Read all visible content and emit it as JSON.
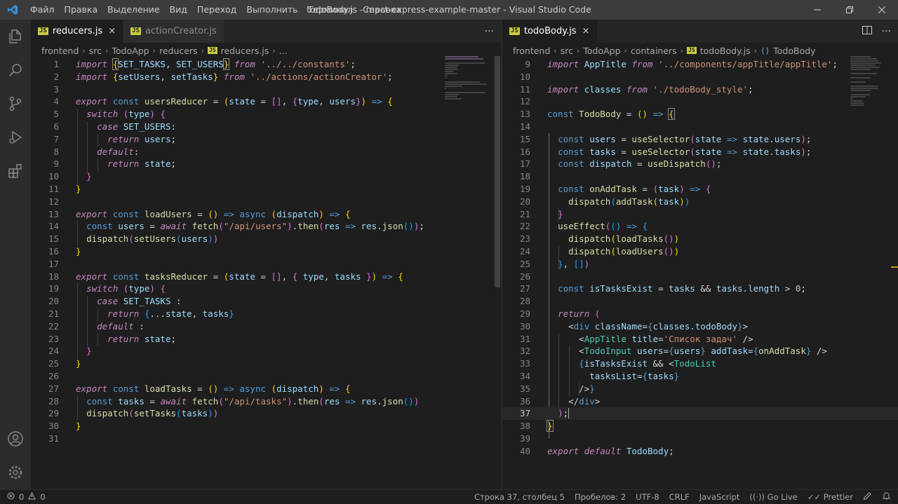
{
  "titlebar": {
    "menu": [
      "Файл",
      "Правка",
      "Выделение",
      "Вид",
      "Переход",
      "Выполнить",
      "Терминал",
      "Справка"
    ],
    "title": "todoBody.js - react-express-example-master - Visual Studio Code"
  },
  "left": {
    "tabs": [
      {
        "label": "reducers.js",
        "badge": "JS",
        "close": "×"
      },
      {
        "label": "actionCreator.js",
        "badge": "JS"
      }
    ],
    "more": "···",
    "breadcrumb": [
      "frontend",
      "src",
      "TodoApp",
      "reducers",
      "reducers.js",
      "..."
    ]
  },
  "right": {
    "tabs": [
      {
        "label": "todoBody.js",
        "badge": "JS",
        "close": "×"
      }
    ],
    "more": "···",
    "breadcrumb": [
      "frontend",
      "src",
      "TodoApp",
      "containers",
      "todoBody.js",
      "TodoBody"
    ]
  },
  "statusbar": {
    "errors": "0",
    "warnings": "0",
    "position": "Строка 37, столбец 5",
    "spaces": "Пробелов: 2",
    "encoding": "UTF-8",
    "eol": "CRLF",
    "language": "JavaScript",
    "golive": "Go Live",
    "prettier": "Prettier"
  },
  "colors": {
    "accent": "#007acc",
    "background": "#1e1e1e"
  }
}
